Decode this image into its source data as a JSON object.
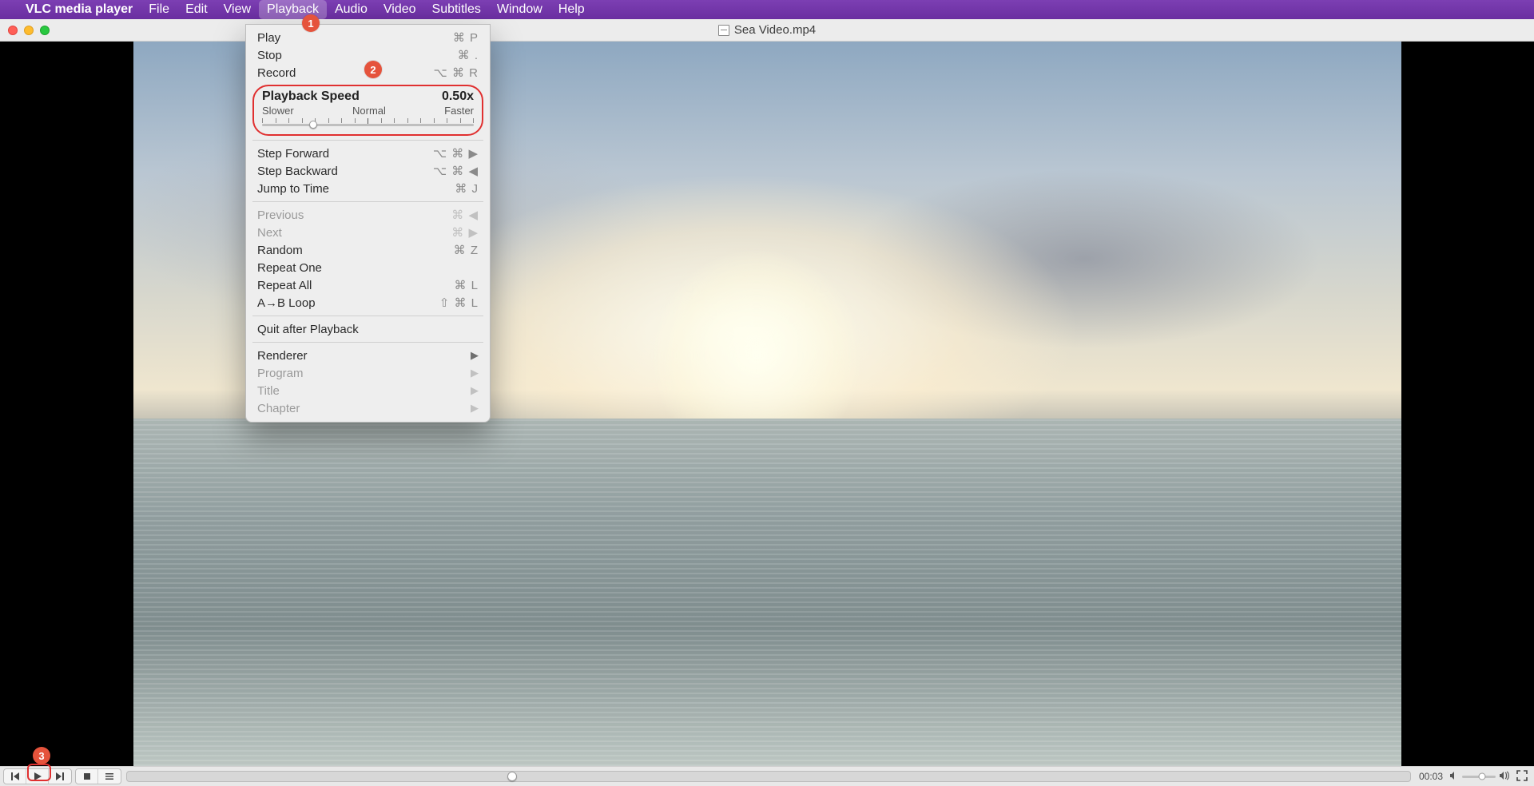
{
  "menubar": {
    "app_name": "VLC media player",
    "items": [
      "File",
      "Edit",
      "View",
      "Playback",
      "Audio",
      "Video",
      "Subtitles",
      "Window",
      "Help"
    ],
    "active_index": 3
  },
  "window": {
    "title": "Sea Video.mp4"
  },
  "dropdown": {
    "play": {
      "label": "Play",
      "shortcut": "⌘ P"
    },
    "stop": {
      "label": "Stop",
      "shortcut": "⌘ ."
    },
    "record": {
      "label": "Record",
      "shortcut": "⌥ ⌘ R"
    },
    "speed": {
      "title": "Playback Speed",
      "value": "0.50x",
      "slower": "Slower",
      "normal": "Normal",
      "faster": "Faster",
      "thumb_pct": 24
    },
    "step_fwd": {
      "label": "Step Forward",
      "shortcut": "⌥ ⌘ ▶"
    },
    "step_bwd": {
      "label": "Step Backward",
      "shortcut": "⌥ ⌘ ◀"
    },
    "jump": {
      "label": "Jump to Time",
      "shortcut": "⌘ J"
    },
    "previous": {
      "label": "Previous",
      "shortcut": "⌘ ◀"
    },
    "next": {
      "label": "Next",
      "shortcut": "⌘ ▶"
    },
    "random": {
      "label": "Random",
      "shortcut": "⌘ Z"
    },
    "repeat_one": {
      "label": "Repeat One",
      "shortcut": ""
    },
    "repeat_all": {
      "label": "Repeat All",
      "shortcut": "⌘ L"
    },
    "ab_loop": {
      "label": "A→B Loop",
      "shortcut": "⇧ ⌘ L"
    },
    "quit_after": {
      "label": "Quit after Playback",
      "shortcut": ""
    },
    "renderer": {
      "label": "Renderer"
    },
    "program": {
      "label": "Program"
    },
    "title_sub": {
      "label": "Title"
    },
    "chapter": {
      "label": "Chapter"
    }
  },
  "annotations": {
    "step1": "1",
    "step2": "2",
    "step3": "3"
  },
  "player": {
    "current_time": "00:03",
    "seek_pct": 30,
    "volume_pct": 60
  }
}
